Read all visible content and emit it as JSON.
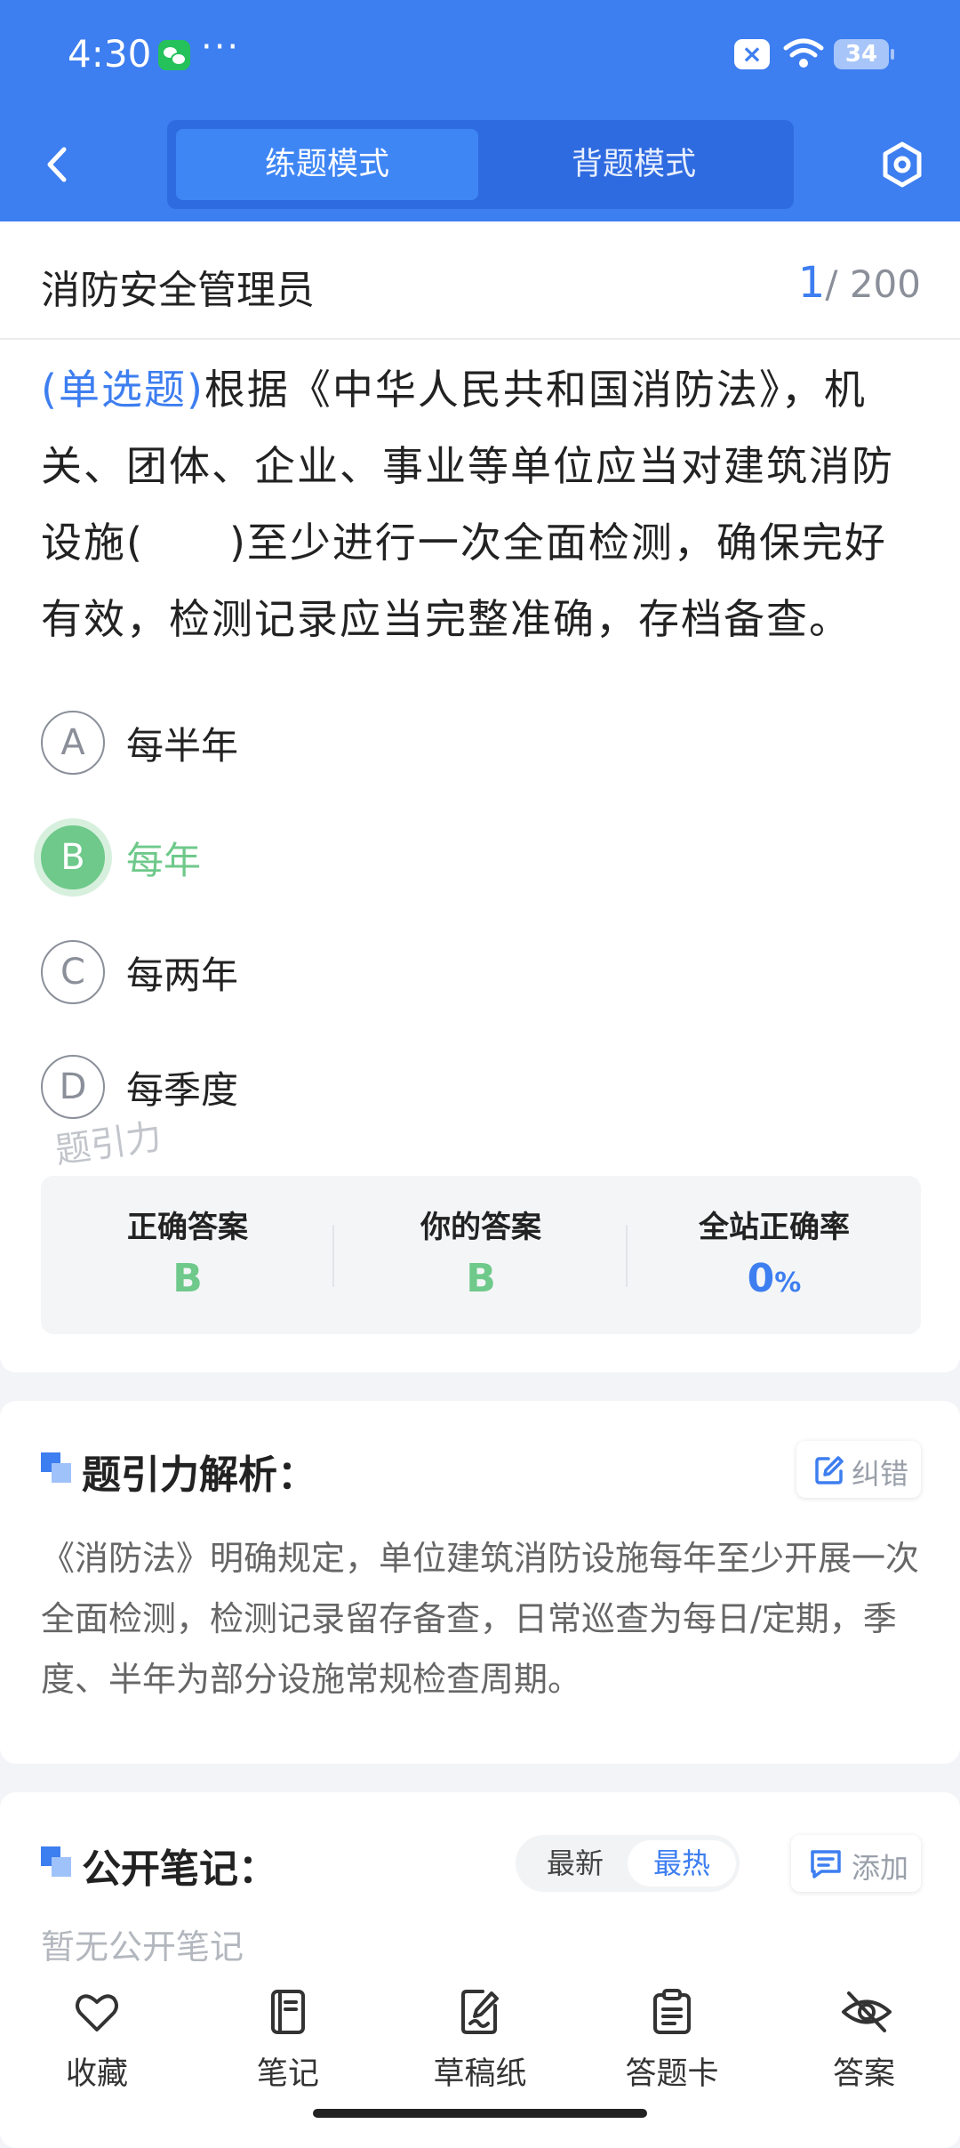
{
  "status_bar": {
    "time": "4:30",
    "dots": "···",
    "battery": "34"
  },
  "nav": {
    "tab_practice": "练题模式",
    "tab_memorize": "背题模式"
  },
  "question_header": {
    "title": "消防安全管理员",
    "current": "1",
    "total": "/ 200"
  },
  "question": {
    "type": "(单选题)",
    "text": "根据《中华人民共和国消防法》，机关、团体、企业、事业等单位应当对建筑消防设施(　　)至少进行一次全面检测，确保完好有效，检测记录应当完整准确，存档备查。"
  },
  "options": [
    {
      "letter": "A",
      "text": "每半年"
    },
    {
      "letter": "B",
      "text": "每年"
    },
    {
      "letter": "C",
      "text": "每两年"
    },
    {
      "letter": "D",
      "text": "每季度"
    }
  ],
  "watermark": "题引力",
  "answers": {
    "correct_label": "正确答案",
    "correct_value": "B",
    "yours_label": "你的答案",
    "yours_value": "B",
    "rate_label": "全站正确率",
    "rate_value": "0",
    "rate_unit": "%"
  },
  "explanation": {
    "title": "题引力解析：",
    "fix_label": "纠错",
    "text": "《消防法》明确规定，单位建筑消防设施每年至少开展一次全面检测，检测记录留存备查，日常巡查为每日/定期，季度、半年为部分设施常规检查周期。"
  },
  "notes": {
    "title": "公开笔记：",
    "sort_latest": "最新",
    "sort_hot": "最热",
    "add_label": "添加",
    "empty": "暂无公开笔记"
  },
  "bottom_bar": [
    {
      "label": "收藏",
      "icon": "heart-icon"
    },
    {
      "label": "笔记",
      "icon": "notebook-icon"
    },
    {
      "label": "草稿纸",
      "icon": "draft-paper-icon"
    },
    {
      "label": "答题卡",
      "icon": "answer-sheet-icon"
    },
    {
      "label": "答案",
      "icon": "eye-off-icon"
    }
  ],
  "colors": {
    "primary": "#3d7ef0",
    "correct": "#6ec98a"
  }
}
